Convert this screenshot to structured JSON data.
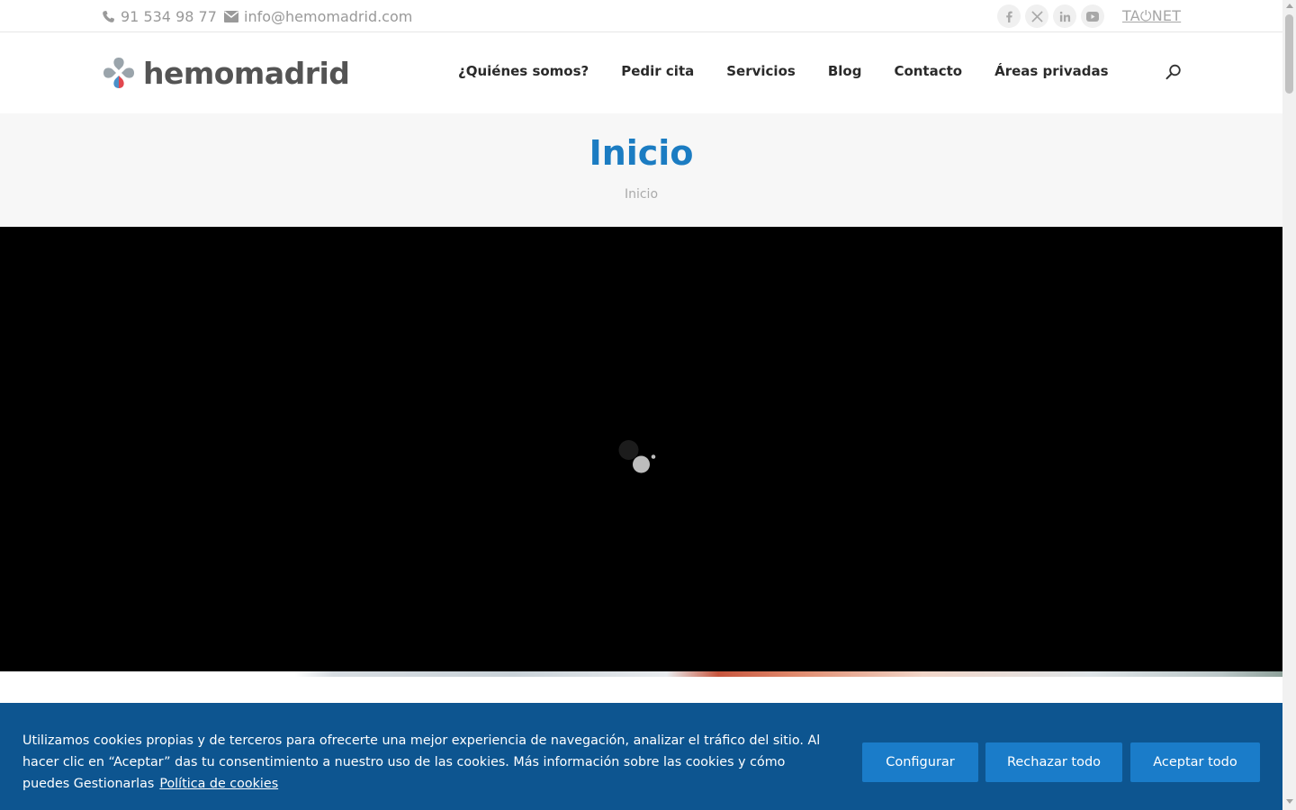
{
  "topbar": {
    "phone": "91 534 98 77",
    "email": "info@hemomadrid.com",
    "socials": [
      {
        "name": "facebook-icon",
        "glyph": "f"
      },
      {
        "name": "x-twitter-icon",
        "glyph": "𝕏"
      },
      {
        "name": "linkedin-icon",
        "glyph": "in"
      },
      {
        "name": "youtube-icon",
        "glyph": "▶"
      }
    ],
    "tao_link": "TA⏻NET"
  },
  "header": {
    "logo_text": "hemomadrid",
    "nav": [
      "¿Quiénes somos?",
      "Pedir cita",
      "Servicios",
      "Blog",
      "Contacto",
      "Áreas privadas"
    ]
  },
  "title_area": {
    "title": "Inicio",
    "breadcrumb": "Inicio"
  },
  "cookie_banner": {
    "text": "Utilizamos cookies propias y de terceros para ofrecerte una mejor experiencia de navegación, analizar el tráfico del sitio. Al hacer clic en “Aceptar” das tu consentimiento a nuestro uso de las cookies. Más información sobre las cookies y cómo puedes Gestionarlas",
    "link": "Política de cookies",
    "buttons": {
      "configure": "Configurar",
      "reject": "Rechazar todo",
      "accept": "Aceptar todo"
    }
  },
  "colors": {
    "brand_blue": "#1b7cc2",
    "cookie_bg": "#0d5590",
    "button_bg": "#1a7cc9"
  }
}
